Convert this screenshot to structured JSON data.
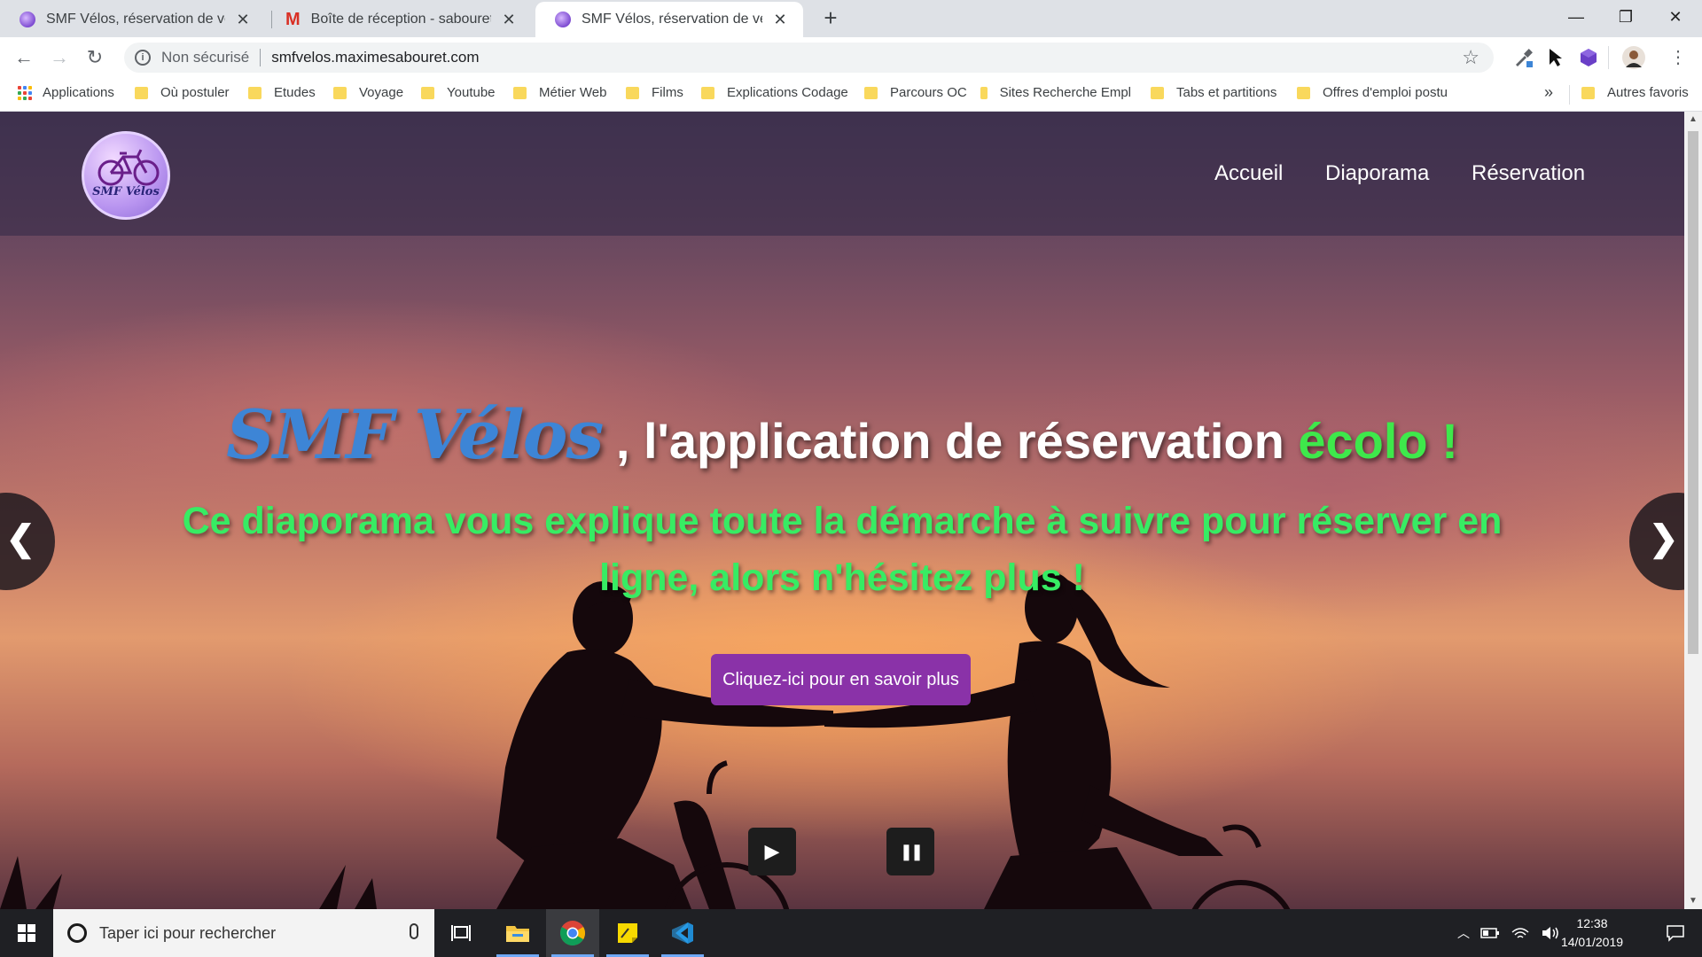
{
  "browser": {
    "tabs": [
      {
        "title": "SMF Vélos, réservation de vélos",
        "icon": "smf-favicon",
        "active": false
      },
      {
        "title": "Boîte de réception - sabouretma",
        "icon": "gmail-icon",
        "active": false
      },
      {
        "title": "SMF Vélos, réservation de vélos",
        "icon": "smf-favicon",
        "active": true
      }
    ],
    "new_tab_label": "+",
    "window_controls": {
      "minimize": "—",
      "maximize": "❐",
      "close": "✕"
    },
    "toolbar": {
      "back": "←",
      "forward": "→",
      "reload": "↻",
      "security_label": "Non sécurisé",
      "url": "smfvelos.maximesabouret.com",
      "star": "☆"
    },
    "bookmarks": [
      {
        "label": "Applications",
        "type": "apps"
      },
      {
        "label": "Où postuler",
        "type": "folder"
      },
      {
        "label": "Etudes",
        "type": "folder"
      },
      {
        "label": "Voyage",
        "type": "folder"
      },
      {
        "label": "Youtube",
        "type": "folder"
      },
      {
        "label": "Métier Web",
        "type": "folder"
      },
      {
        "label": "Films",
        "type": "folder"
      },
      {
        "label": "Explications Codage",
        "type": "folder"
      },
      {
        "label": "Parcours OC",
        "type": "folder"
      },
      {
        "label": "Sites Recherche Empl",
        "type": "folder"
      },
      {
        "label": "Tabs et partitions",
        "type": "folder"
      },
      {
        "label": "Offres d'emploi postu",
        "type": "folder"
      }
    ],
    "bookmarks_more": "»",
    "other_bookmarks": "Autres favoris"
  },
  "site": {
    "logo_text": "SMF Vélos",
    "nav": [
      "Accueil",
      "Diaporama",
      "Réservation"
    ],
    "hero": {
      "brand": "SMF Vélos",
      "headline_middle": " , l'application de réservation ",
      "headline_eco": "écolo !",
      "subline": "Ce diaporama vous explique toute la démarche à suivre pour réserver en ligne, alors n'hésitez plus !",
      "cta": "Cliquez-ici pour en savoir plus"
    },
    "slider": {
      "prev": "❮",
      "next": "❯",
      "play": "▶",
      "pause": "❚❚"
    },
    "colors": {
      "brand_blue": "#3d85d6",
      "eco_green": "#3ee84b",
      "subline_green": "#37ec63",
      "cta_purple": "#8a32a8"
    }
  },
  "taskbar": {
    "search_placeholder": "Taper ici pour rechercher",
    "time": "12:38",
    "date": "14/01/2019"
  }
}
